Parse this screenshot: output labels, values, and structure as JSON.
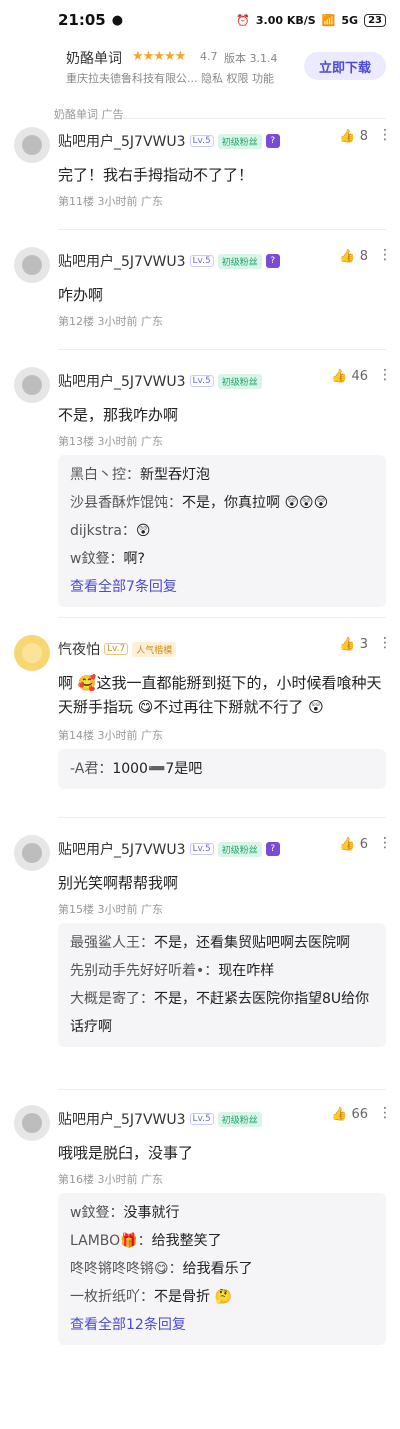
{
  "status": {
    "time": "21:05",
    "speed": "3.00 KB/S",
    "signal": "5G",
    "battery": "23"
  },
  "ad": {
    "app_name": "奶酪单词",
    "stars": "★★★★★",
    "rating": "4.7",
    "version": "版本 3.1.4",
    "company": "重庆拉夫德鲁科技有限公...  隐私  权限  功能",
    "download": "立即下载",
    "tag": "奶酪单词  广告"
  },
  "posts": [
    {
      "user": "贴吧用户_5J7VWU3",
      "lv": "Lv.5",
      "fan": "初级粉丝",
      "likes": "8",
      "text": "完了！我右手拇指动不了了！",
      "floor": "第11楼  3小时前  广东"
    },
    {
      "user": "贴吧用户_5J7VWU3",
      "lv": "Lv.5",
      "fan": "初级粉丝",
      "likes": "8",
      "text": "咋办啊",
      "floor": "第12楼  3小时前  广东"
    },
    {
      "user": "贴吧用户_5J7VWU3",
      "lv": "Lv.5",
      "fan": "初级粉丝",
      "likes": "46",
      "text": "不是，那我咋办啊",
      "floor": "第13楼  3小时前  广东",
      "replies": [
        {
          "who": "黑白丶控：",
          "msg": "新型吞灯泡"
        },
        {
          "who": "沙县香酥炸馄饨：",
          "msg": "不是，你真拉啊 😲😲😲"
        },
        {
          "who": "dijkstra：",
          "msg": "😲"
        },
        {
          "who": "w鈫豋：",
          "msg": "啊?"
        }
      ],
      "view_all": "查看全部7条回复"
    },
    {
      "user": "忾夜怕",
      "lv": "Lv.7",
      "fan": "人气楷模",
      "likes": "3",
      "text": "啊 🥰这我一直都能掰到挺下的，小时候看喰种天天掰手指玩 😋不过再往下掰就不行了 😲",
      "floor": "第14楼  3小时前  广东",
      "replies": [
        {
          "who": "-A君：",
          "msg": "1000➖7是吧"
        }
      ]
    },
    {
      "user": "贴吧用户_5J7VWU3",
      "lv": "Lv.5",
      "fan": "初级粉丝",
      "likes": "6",
      "text": "别光笑啊帮帮我啊",
      "floor": "第15楼  3小时前  广东",
      "replies": [
        {
          "who": "最强鲨人王：",
          "msg": "不是，还看集贸贴吧啊去医院啊"
        },
        {
          "who": "先别动手先好好听着•：",
          "msg": "现在咋样"
        },
        {
          "who": "大概是寄了：",
          "msg": "不是，不赶紧去医院你指望8U给你话疗啊"
        }
      ]
    },
    {
      "user": "贴吧用户_5J7VWU3",
      "lv": "Lv.5",
      "fan": "初级粉丝",
      "likes": "66",
      "text": "哦哦是脱臼，没事了",
      "floor": "第16楼  3小时前  广东",
      "replies": [
        {
          "who": "w鈫豋：",
          "msg": "没事就行"
        },
        {
          "who": "LAMBO🎁：",
          "msg": "给我整笑了"
        },
        {
          "who": "咚咚锵咚咚锵😋：",
          "msg": "给我看乐了"
        },
        {
          "who": "一枚折纸吖：",
          "msg": "不是骨折 🤔"
        }
      ],
      "view_all": "查看全部12条回复"
    }
  ]
}
